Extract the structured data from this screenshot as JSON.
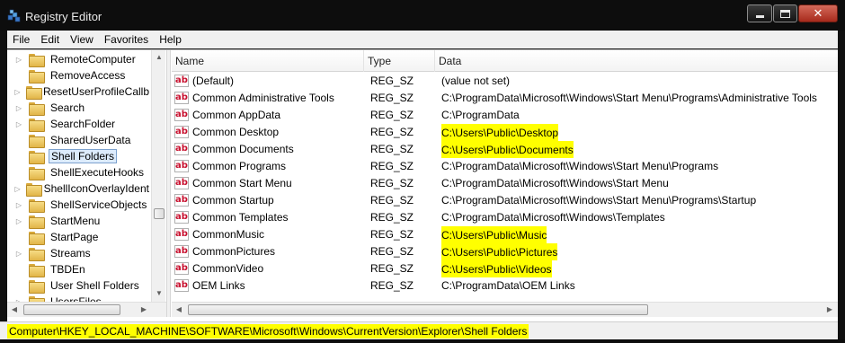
{
  "window": {
    "title": "Registry Editor"
  },
  "menu": [
    "File",
    "Edit",
    "View",
    "Favorites",
    "Help"
  ],
  "tree": {
    "items": [
      {
        "label": "RemoteComputer",
        "expander": "▷"
      },
      {
        "label": "RemoveAccess",
        "expander": ""
      },
      {
        "label": "ResetUserProfileCallb",
        "expander": "▷"
      },
      {
        "label": "Search",
        "expander": "▷"
      },
      {
        "label": "SearchFolder",
        "expander": "▷"
      },
      {
        "label": "SharedUserData",
        "expander": ""
      },
      {
        "label": "Shell Folders",
        "expander": "",
        "selected": true
      },
      {
        "label": "ShellExecuteHooks",
        "expander": ""
      },
      {
        "label": "ShellIconOverlayIdent",
        "expander": "▷"
      },
      {
        "label": "ShellServiceObjects",
        "expander": "▷"
      },
      {
        "label": "StartMenu",
        "expander": "▷"
      },
      {
        "label": "StartPage",
        "expander": ""
      },
      {
        "label": "Streams",
        "expander": "▷"
      },
      {
        "label": "TBDEn",
        "expander": ""
      },
      {
        "label": "User Shell Folders",
        "expander": ""
      },
      {
        "label": "UsersFiles",
        "expander": "▷"
      }
    ]
  },
  "list": {
    "columns": [
      "Name",
      "Type",
      "Data"
    ],
    "rows": [
      {
        "name": "(Default)",
        "type": "REG_SZ",
        "data": "(value not set)",
        "highlight": false
      },
      {
        "name": "Common Administrative Tools",
        "type": "REG_SZ",
        "data": "C:\\ProgramData\\Microsoft\\Windows\\Start Menu\\Programs\\Administrative Tools",
        "highlight": false
      },
      {
        "name": "Common AppData",
        "type": "REG_SZ",
        "data": "C:\\ProgramData",
        "highlight": false
      },
      {
        "name": "Common Desktop",
        "type": "REG_SZ",
        "data": "C:\\Users\\Public\\Desktop",
        "highlight": true
      },
      {
        "name": "Common Documents",
        "type": "REG_SZ",
        "data": "C:\\Users\\Public\\Documents",
        "highlight": true
      },
      {
        "name": "Common Programs",
        "type": "REG_SZ",
        "data": "C:\\ProgramData\\Microsoft\\Windows\\Start Menu\\Programs",
        "highlight": false
      },
      {
        "name": "Common Start Menu",
        "type": "REG_SZ",
        "data": "C:\\ProgramData\\Microsoft\\Windows\\Start Menu",
        "highlight": false
      },
      {
        "name": "Common Startup",
        "type": "REG_SZ",
        "data": "C:\\ProgramData\\Microsoft\\Windows\\Start Menu\\Programs\\Startup",
        "highlight": false
      },
      {
        "name": "Common Templates",
        "type": "REG_SZ",
        "data": "C:\\ProgramData\\Microsoft\\Windows\\Templates",
        "highlight": false
      },
      {
        "name": "CommonMusic",
        "type": "REG_SZ",
        "data": "C:\\Users\\Public\\Music",
        "highlight": true
      },
      {
        "name": "CommonPictures",
        "type": "REG_SZ",
        "data": "C:\\Users\\Public\\Pictures",
        "highlight": true
      },
      {
        "name": "CommonVideo",
        "type": "REG_SZ",
        "data": "C:\\Users\\Public\\Videos",
        "highlight": true
      },
      {
        "name": "OEM Links",
        "type": "REG_SZ",
        "data": "C:\\ProgramData\\OEM Links",
        "highlight": false
      }
    ]
  },
  "status": {
    "path": "Computer\\HKEY_LOCAL_MACHINE\\SOFTWARE\\Microsoft\\Windows\\CurrentVersion\\Explorer\\Shell Folders"
  },
  "colors": {
    "highlight": "#ffff00",
    "selection": "#dcebfc",
    "value_icon": "#c8102e"
  },
  "icons": {
    "value_type": "ab-icon",
    "folder": "folder-icon"
  }
}
